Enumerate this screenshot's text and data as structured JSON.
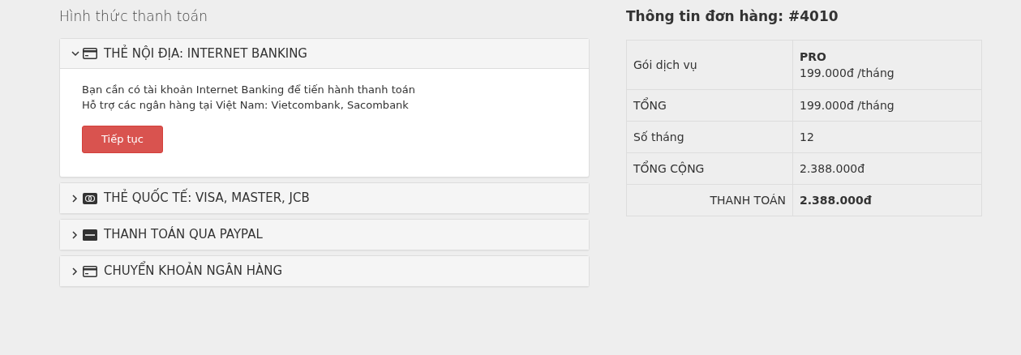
{
  "payment": {
    "title": "Hình thức thanh toán",
    "methods": [
      {
        "label": "THẺ NỘI ĐỊA: INTERNET BANKING",
        "kind": "card",
        "expanded": true,
        "lines": [
          "Bạn cần có tài khoản Internet Banking để tiến hành thanh toán",
          "Hỗ trợ các ngân hàng tại Việt Nam: Vietcombank, Sacombank"
        ],
        "button": "Tiếp tục"
      },
      {
        "label": "THẺ QUỐC TẾ: VISA, MASTER, JCB",
        "kind": "intl",
        "expanded": false
      },
      {
        "label": "THANH TOÁN QUA PAYPAL",
        "kind": "paypal",
        "expanded": false
      },
      {
        "label": "CHUYỂN KHOẢN NGÂN HÀNG",
        "kind": "card",
        "expanded": false
      }
    ]
  },
  "order": {
    "title": "Thông tin đơn hàng: #4010",
    "rows": [
      {
        "kind": "plan",
        "label": "Gói dịch vụ",
        "plan": "PRO",
        "value": "199.000đ /tháng"
      },
      {
        "kind": "plain",
        "label": "TỔNG",
        "value": "199.000đ /tháng"
      },
      {
        "kind": "plain",
        "label": "Số tháng",
        "value": "12"
      },
      {
        "kind": "plain",
        "label": "TỔNG CỘNG",
        "value": "2.388.000đ"
      },
      {
        "kind": "total",
        "label": "THANH TOÁN",
        "value": "2.388.000đ"
      }
    ]
  }
}
